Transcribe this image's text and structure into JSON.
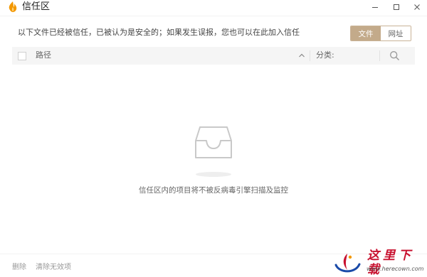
{
  "window": {
    "title": "信任区"
  },
  "notice": "以下文件已经被信任，已被认为是安全的；如果发生误报，您也可以在此加入信任",
  "tabs": [
    {
      "label": "文件",
      "selected": true
    },
    {
      "label": "网址",
      "selected": false
    }
  ],
  "table": {
    "col_path": "路径",
    "col_category": "分类:"
  },
  "empty_state": {
    "message": "信任区内的项目将不被反病毒引擎扫描及监控"
  },
  "footer": {
    "delete_label": "删除",
    "clear_invalid_label": "清除无效项"
  },
  "watermark": {
    "name": "这里下载",
    "url": "www.herecown.com"
  },
  "colors": {
    "accent": "#c3aa8a",
    "header_bg": "#f5f5f5",
    "logo": "#f39800",
    "watermark": "#c8102e"
  },
  "icons": [
    "app-logo-icon",
    "minimize-icon",
    "maximize-icon",
    "close-icon",
    "sort-up-icon",
    "search-icon",
    "empty-inbox-icon",
    "watermark-logo-icon"
  ]
}
